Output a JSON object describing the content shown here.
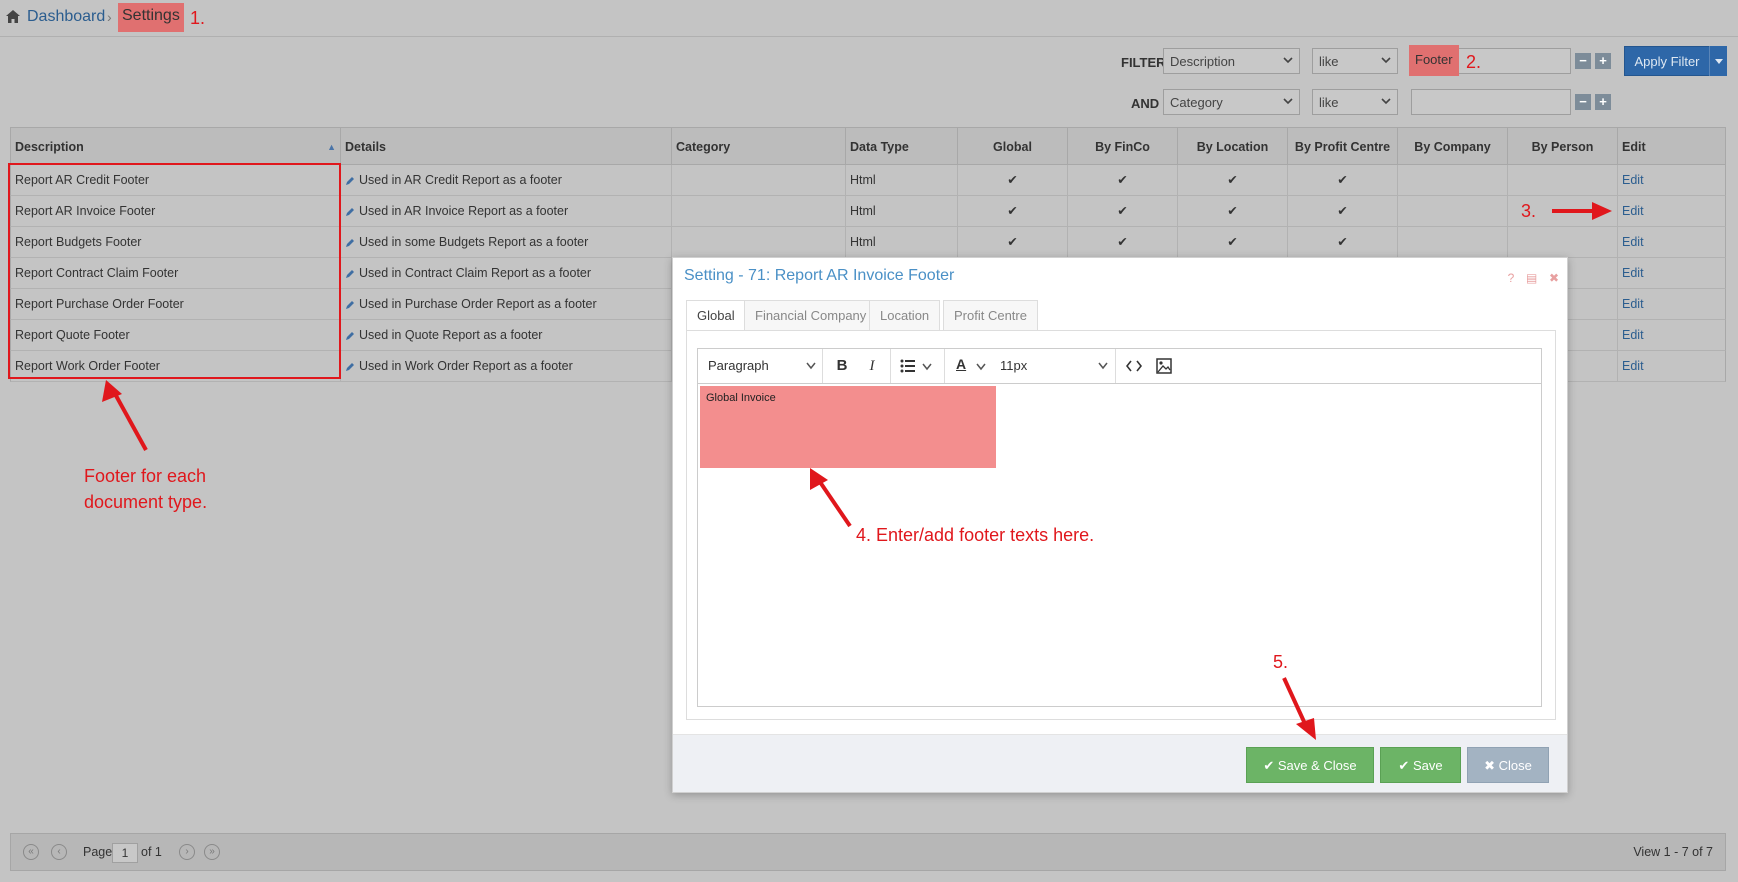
{
  "breadcrumb": {
    "home": "Dashboard",
    "current": "Settings"
  },
  "filter": {
    "label": "FILTER",
    "and_label": "AND",
    "row1": {
      "field": "Description",
      "op": "like",
      "value": "Footer"
    },
    "row2": {
      "field": "Category",
      "op": "like",
      "value": ""
    },
    "apply_label": "Apply Filter",
    "minus": "−",
    "plus": "+"
  },
  "grid": {
    "columns": [
      "Description",
      "Details",
      "Category",
      "Data Type",
      "Global",
      "By FinCo",
      "By Location",
      "By Profit Centre",
      "By Company",
      "By Person",
      "Edit"
    ],
    "rows": [
      {
        "description": "Report AR Credit Footer",
        "details": "Used in AR Credit Report as a footer",
        "category": "",
        "data_type": "Html",
        "global": "✔",
        "finco": "✔",
        "location": "✔",
        "profit": "✔",
        "company": "",
        "person": "",
        "edit": "Edit"
      },
      {
        "description": "Report AR Invoice Footer",
        "details": "Used in AR Invoice Report as a footer",
        "category": "",
        "data_type": "Html",
        "global": "✔",
        "finco": "✔",
        "location": "✔",
        "profit": "✔",
        "company": "",
        "person": "",
        "edit": "Edit"
      },
      {
        "description": "Report Budgets Footer",
        "details": "Used in some Budgets Report as a footer",
        "category": "",
        "data_type": "Html",
        "global": "✔",
        "finco": "✔",
        "location": "✔",
        "profit": "✔",
        "company": "",
        "person": "",
        "edit": "Edit"
      },
      {
        "description": "Report Contract Claim Footer",
        "details": "Used in Contract Claim Report as a footer",
        "category": "",
        "data_type": "",
        "global": "",
        "finco": "",
        "location": "",
        "profit": "",
        "company": "",
        "person": "",
        "edit": "Edit"
      },
      {
        "description": "Report Purchase Order Footer",
        "details": "Used in Purchase Order Report as a footer",
        "category": "",
        "data_type": "",
        "global": "",
        "finco": "",
        "location": "",
        "profit": "",
        "company": "",
        "person": "",
        "edit": "Edit"
      },
      {
        "description": "Report Quote Footer",
        "details": "Used in Quote Report as a footer",
        "category": "",
        "data_type": "",
        "global": "",
        "finco": "",
        "location": "",
        "profit": "",
        "company": "",
        "person": "",
        "edit": "Edit"
      },
      {
        "description": "Report Work Order Footer",
        "details": "Used in Work Order Report as a footer",
        "category": "",
        "data_type": "",
        "global": "",
        "finco": "",
        "location": "",
        "profit": "",
        "company": "",
        "person": "",
        "edit": "Edit"
      }
    ]
  },
  "pager": {
    "page_label": "Page",
    "page": "1",
    "of": "of 1",
    "view": "View 1 - 7 of 7"
  },
  "modal": {
    "title": "Setting - 71: Report AR Invoice Footer",
    "tabs": [
      "Global",
      "Financial Company",
      "Location",
      "Profit Centre"
    ],
    "editor": {
      "block_format": "Paragraph",
      "font_size": "11px",
      "content": "Global Invoice"
    },
    "buttons": {
      "save_close": "Save & Close",
      "save": "Save",
      "close": "Close"
    }
  },
  "annotations": {
    "a1": "1.",
    "a2": "2.",
    "a3": "3.",
    "a4": "4. Enter/add footer texts here.",
    "a5": "5.",
    "footer_line1": "Footer for each",
    "footer_line2": "document type."
  },
  "colors": {
    "annotation": "#e0171c",
    "highlight": "#e07070",
    "link": "#2b5d8f",
    "apply": "#2e67a8",
    "save": "#6cb466"
  }
}
